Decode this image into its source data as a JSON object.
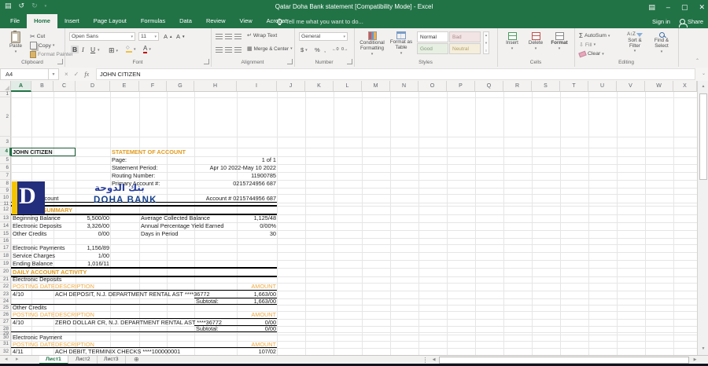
{
  "window": {
    "title": "Qatar Doha Bank statement  [Compatibility Mode] - Excel",
    "sign_in": "Sign in",
    "share": "Share"
  },
  "menu_tabs": {
    "items": [
      {
        "label": "File"
      },
      {
        "label": "Home"
      },
      {
        "label": "Insert"
      },
      {
        "label": "Page Layout"
      },
      {
        "label": "Formulas"
      },
      {
        "label": "Data"
      },
      {
        "label": "Review"
      },
      {
        "label": "View"
      },
      {
        "label": "Acrobat"
      }
    ],
    "active": "Home",
    "tell_me": "Tell me what you want to do..."
  },
  "ribbon": {
    "clipboard": {
      "label": "Clipboard",
      "paste": "Paste",
      "cut": "Cut",
      "copy": "Copy",
      "format_painter": "Format Painter"
    },
    "font": {
      "label": "Font",
      "name": "Open Sans",
      "size": "11"
    },
    "alignment": {
      "label": "Alignment",
      "wrap_text": "Wrap Text",
      "merge_center": "Merge & Center"
    },
    "number": {
      "label": "Number",
      "format": "General"
    },
    "styles": {
      "label": "Styles",
      "conditional": "Conditional Formatting",
      "format_table": "Format as Table",
      "gallery": [
        "Normal",
        "Bad",
        "Good",
        "Neutral"
      ]
    },
    "cells": {
      "label": "Cells",
      "insert": "Insert",
      "delete": "Delete",
      "format": "Format"
    },
    "editing": {
      "label": "Editing",
      "autosum": "AutoSum",
      "fill": "Fill",
      "clear": "Clear",
      "sort": "Sort & Filter",
      "find": "Find & Select"
    }
  },
  "formula_bar": {
    "name_box": "A4",
    "formula": "JOHN CITIZEN"
  },
  "logo": {
    "arabic": "بنك الدوحة",
    "name": "DOHA BANK"
  },
  "sheet": {
    "columns": [
      "A",
      "B",
      "C",
      "D",
      "E",
      "F",
      "G",
      "H",
      "I",
      "J",
      "K",
      "L",
      "M",
      "N",
      "O",
      "P",
      "Q",
      "R",
      "S",
      "T",
      "U",
      "V",
      "W",
      "X"
    ],
    "active_cell": "A4",
    "selected_column": "A",
    "selected_row": 4,
    "rows": [
      {
        "n": 1,
        "cells": []
      },
      {
        "n": 2,
        "cells": []
      },
      {
        "n": 3,
        "cells": []
      },
      {
        "n": 4,
        "cells": [
          {
            "col": "A",
            "text": "JOHN CITIZEN",
            "style": "bold"
          },
          {
            "col": "E",
            "text": "STATEMENT OF ACCOUNT",
            "style": "orange-bold"
          }
        ]
      },
      {
        "n": 5,
        "cells": [
          {
            "col": "E",
            "text": "Page:"
          },
          {
            "col": "I",
            "text": "1 of 1",
            "align": "right"
          }
        ]
      },
      {
        "n": 6,
        "cells": [
          {
            "col": "E",
            "text": "Statement Period:"
          },
          {
            "col": "I",
            "text": "Apr 10 2022-May 10 2022",
            "align": "right"
          }
        ]
      },
      {
        "n": 7,
        "cells": [
          {
            "col": "E",
            "text": "Routing Number:"
          },
          {
            "col": "I",
            "text": "11900785",
            "align": "right"
          }
        ]
      },
      {
        "n": 8,
        "cells": [
          {
            "col": "E",
            "text": "Primary Account #:"
          },
          {
            "col": "I",
            "text": "0215724956 687",
            "align": "right"
          }
        ]
      },
      {
        "n": 9,
        "cells": []
      },
      {
        "n": 10,
        "cells": [
          {
            "col": "A",
            "text": "Checking Account"
          },
          {
            "col": "I",
            "text": "Account # 0215744956 687",
            "align": "right"
          }
        ]
      },
      {
        "n": 11,
        "cells": []
      },
      {
        "n": 12,
        "cells": [
          {
            "col": "A",
            "text": "ACCOUNT SUMMARY",
            "style": "orange-bold"
          }
        ]
      },
      {
        "n": 13,
        "cells": [
          {
            "col": "A",
            "text": "Beginning Balance"
          },
          {
            "col": "D",
            "text": "5,500/00",
            "align": "right"
          },
          {
            "col": "F",
            "text": "Average Collected Balance"
          },
          {
            "col": "I",
            "text": "1,125/48",
            "align": "right"
          }
        ]
      },
      {
        "n": 14,
        "cells": [
          {
            "col": "A",
            "text": "Electronic Deposits"
          },
          {
            "col": "D",
            "text": "3,326/00",
            "align": "right"
          },
          {
            "col": "F",
            "text": "Annual Percentage Yield Earned"
          },
          {
            "col": "I",
            "text": "0/00%",
            "align": "right"
          }
        ]
      },
      {
        "n": 15,
        "cells": [
          {
            "col": "A",
            "text": "Other Credits"
          },
          {
            "col": "D",
            "text": "0/00",
            "align": "right"
          },
          {
            "col": "F",
            "text": "Days in Period"
          },
          {
            "col": "I",
            "text": "30",
            "align": "right"
          }
        ]
      },
      {
        "n": 16,
        "cells": []
      },
      {
        "n": 17,
        "cells": [
          {
            "col": "A",
            "text": "Electronic Payments"
          },
          {
            "col": "D",
            "text": "1,156/89",
            "align": "right"
          }
        ]
      },
      {
        "n": 18,
        "cells": [
          {
            "col": "A",
            "text": "Service Charges"
          },
          {
            "col": "D",
            "text": "1/00",
            "align": "right"
          }
        ]
      },
      {
        "n": 19,
        "cells": [
          {
            "col": "A",
            "text": "Ending Balance"
          },
          {
            "col": "D",
            "text": "1,016/11",
            "align": "right"
          }
        ]
      },
      {
        "n": 20,
        "cells": [
          {
            "col": "A",
            "text": "DAILY ACCOUNT ACTIVITY",
            "style": "orange-bold"
          }
        ]
      },
      {
        "n": 21,
        "cells": [
          {
            "col": "A",
            "text": "Electronic Deposits"
          }
        ]
      },
      {
        "n": 22,
        "cells": [
          {
            "col": "A",
            "text": "POSTING DATE",
            "style": "orange"
          },
          {
            "col": "C",
            "text": "DESCRIPTION",
            "style": "orange"
          },
          {
            "col": "I",
            "text": "AMOUNT",
            "align": "right",
            "style": "orange"
          }
        ]
      },
      {
        "n": 23,
        "cells": [
          {
            "col": "A",
            "text": "4/10"
          },
          {
            "col": "C",
            "text": "ACH DEPOSIT, N.J. DEPARTMENT RENTAL AST ****36772"
          },
          {
            "col": "I",
            "text": "1,663/00",
            "align": "right"
          }
        ]
      },
      {
        "n": 24,
        "cells": [
          {
            "col": "H",
            "text": "Subtotal:"
          },
          {
            "col": "I",
            "text": "1,663/00",
            "align": "right"
          }
        ]
      },
      {
        "n": 25,
        "cells": [
          {
            "col": "A",
            "text": "Other Credits"
          }
        ]
      },
      {
        "n": 26,
        "cells": [
          {
            "col": "A",
            "text": "POSTING DATE",
            "style": "orange"
          },
          {
            "col": "C",
            "text": "DESCRIPTION",
            "style": "orange"
          },
          {
            "col": "I",
            "text": "AMOUNT",
            "align": "right",
            "style": "orange"
          }
        ]
      },
      {
        "n": 27,
        "cells": [
          {
            "col": "A",
            "text": "4/10"
          },
          {
            "col": "C",
            "text": "ZERO DOLLAR CR, N.J. DEPARTMENT RENTAL AST ****36772"
          },
          {
            "col": "I",
            "text": "0/00",
            "align": "right"
          }
        ]
      },
      {
        "n": 28,
        "cells": [
          {
            "col": "H",
            "text": "Subtotal:"
          },
          {
            "col": "I",
            "text": "0/00",
            "align": "right"
          }
        ]
      },
      {
        "n": 29,
        "cells": []
      },
      {
        "n": 30,
        "cells": [
          {
            "col": "A",
            "text": "Electronic Payment"
          }
        ]
      },
      {
        "n": 31,
        "cells": [
          {
            "col": "A",
            "text": "POSTING DATE",
            "style": "orange"
          },
          {
            "col": "C",
            "text": "DESCRIPTION",
            "style": "orange"
          },
          {
            "col": "I",
            "text": "AMOUNT",
            "align": "right",
            "style": "orange"
          }
        ]
      },
      {
        "n": 32,
        "cells": [
          {
            "col": "A",
            "text": "4/11"
          },
          {
            "col": "C",
            "text": "ACH DEBIT, TERMINIX CHECKS ****100000001"
          },
          {
            "col": "I",
            "text": "107/02",
            "align": "right"
          }
        ]
      }
    ]
  },
  "sheet_tabs": {
    "items": [
      "Лист1",
      "Лист2",
      "Лист3"
    ],
    "active": "Лист1"
  },
  "colors": {
    "excel_green": "#217346",
    "accent_orange": "#e09b21",
    "logo_navy": "#232e7c",
    "logo_yellow": "#f5c400"
  }
}
